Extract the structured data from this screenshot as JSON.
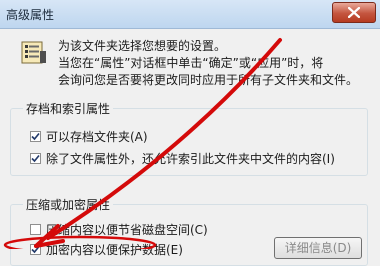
{
  "window": {
    "title": "高级属性"
  },
  "intro": {
    "line1": "为该文件夹选择您想要的设置。",
    "line2": "当您在“属性”对话框中单击“确定”或“应用”时，将",
    "line3": "会询问您是否要将更改同时应用于所有子文件夹和文件。"
  },
  "archive_group": {
    "label": "存档和索引属性",
    "archive_label": "可以存档文件夹(A)",
    "archive_checked": true,
    "index_label": "除了文件属性外，还允许索引此文件夹中文件的内容(I)",
    "index_checked": true
  },
  "compress_group": {
    "label": "压缩或加密属性",
    "compress_label": "压缩内容以便节省磁盘空间(C)",
    "compress_checked": false,
    "encrypt_label": "加密内容以便保护数据(E)",
    "encrypt_checked": true,
    "details_label": "详细信息(D)"
  },
  "colors": {
    "annotation_arrow": "#d40a0a"
  }
}
